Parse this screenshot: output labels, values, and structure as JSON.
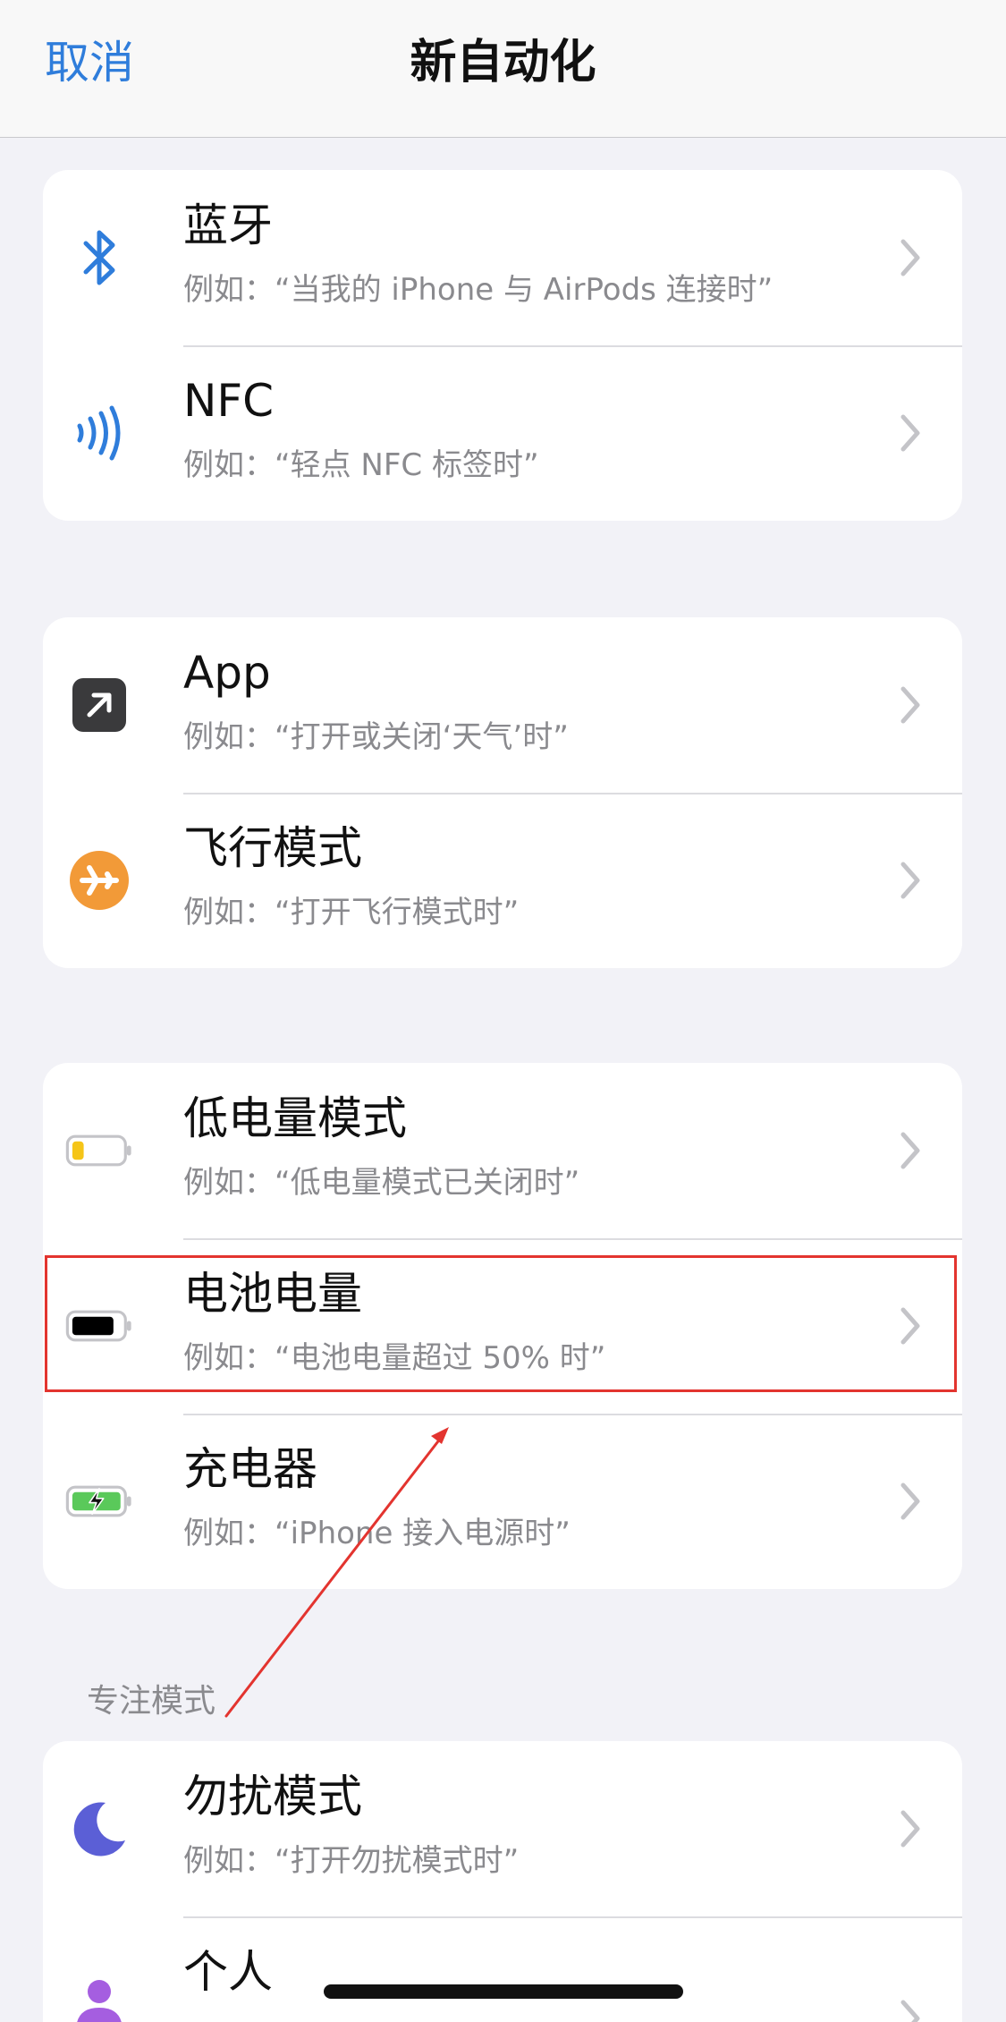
{
  "nav": {
    "cancel_label": "取消",
    "title": "新自动化"
  },
  "groups": [
    {
      "rows": [
        {
          "title": "蓝牙",
          "subtitle": "例如：“当我的 iPhone 与 AirPods 连接时”",
          "icon": "bluetooth-icon"
        },
        {
          "title": "NFC",
          "subtitle": "例如：“轻点 NFC 标签时”",
          "icon": "nfc-icon"
        }
      ]
    },
    {
      "rows": [
        {
          "title": "App",
          "subtitle": "例如：“打开或关闭‘天气’时”",
          "icon": "app-arrow-icon"
        },
        {
          "title": "飞行模式",
          "subtitle": "例如：“打开飞行模式时”",
          "icon": "airplane-icon"
        }
      ]
    },
    {
      "rows": [
        {
          "title": "低电量模式",
          "subtitle": "例如：“低电量模式已关闭时”",
          "icon": "low-battery-icon"
        },
        {
          "title": "电池电量",
          "subtitle": "例如：“电池电量超过 50% 时”",
          "icon": "battery-full-icon"
        },
        {
          "title": "充电器",
          "subtitle": "例如：“iPhone 接入电源时”",
          "icon": "charging-battery-icon"
        }
      ]
    },
    {
      "header": "专注模式",
      "rows": [
        {
          "title": "勿扰模式",
          "subtitle": "例如：“打开勿扰模式时”",
          "icon": "moon-icon"
        },
        {
          "title": "个人",
          "subtitle": "",
          "icon": "person-icon"
        }
      ]
    }
  ],
  "colors": {
    "accent_blue": "#2f7ddb",
    "airplane_orange": "#f29a38",
    "battery_yellow": "#f5c518",
    "battery_green": "#5ac95a",
    "moon_purple": "#5b5fd6",
    "person_purple": "#a55ee0",
    "highlight_red": "#e3342f"
  }
}
